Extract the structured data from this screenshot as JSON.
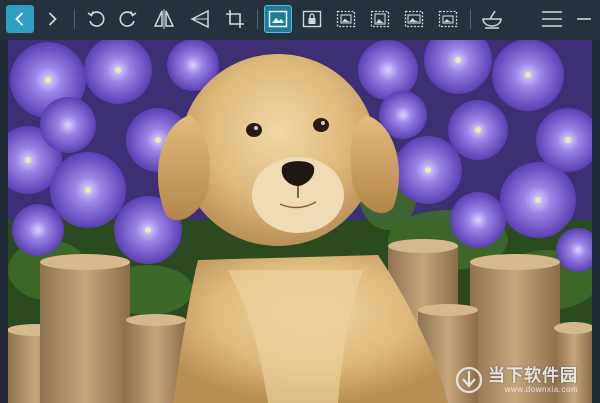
{
  "toolbar": {
    "items": [
      {
        "id": "prev",
        "icon": "chevron-left-icon"
      },
      {
        "id": "next",
        "icon": "chevron-right-icon"
      },
      {
        "id": "rotate-left",
        "icon": "rotate-ccw-icon"
      },
      {
        "id": "rotate-right",
        "icon": "rotate-cw-icon"
      },
      {
        "id": "flip-horizontal",
        "icon": "flip-horizontal-icon"
      },
      {
        "id": "flip-vertical",
        "icon": "flip-vertical-icon"
      },
      {
        "id": "crop",
        "icon": "crop-icon"
      },
      {
        "id": "image-mode-1",
        "icon": "image-frame-icon"
      },
      {
        "id": "image-mode-lock",
        "icon": "image-lock-icon"
      },
      {
        "id": "image-mode-3",
        "icon": "image-dashed-icon"
      },
      {
        "id": "image-mode-4",
        "icon": "image-dashed-icon"
      },
      {
        "id": "image-mode-5",
        "icon": "image-dashed-icon"
      },
      {
        "id": "image-mode-6",
        "icon": "image-dashed-icon"
      },
      {
        "id": "clean",
        "icon": "bowl-icon"
      },
      {
        "id": "menu",
        "icon": "hamburger-menu-icon"
      },
      {
        "id": "minimize",
        "icon": "minimize-icon"
      }
    ],
    "accent": "#2f9fc2"
  },
  "photo": {
    "subject": "puppy-photo"
  },
  "watermark": {
    "logo_icon": "downxia-logo-icon",
    "text_cn": "当下软件园",
    "url": "www.downxia.com"
  }
}
